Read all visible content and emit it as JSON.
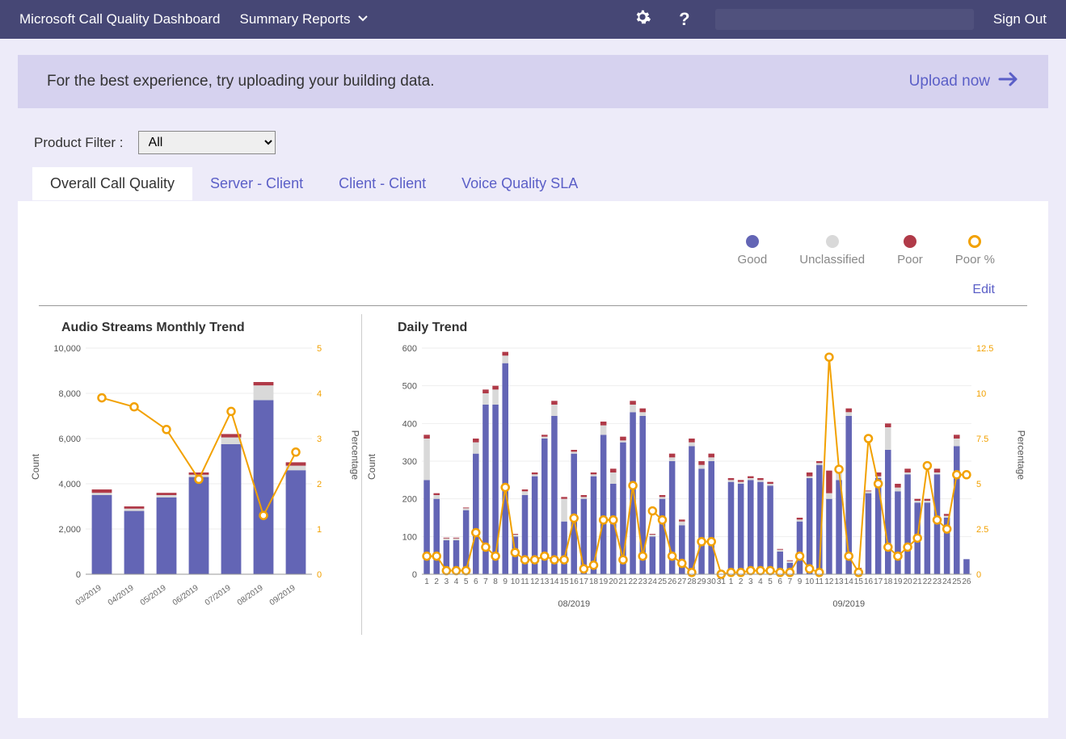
{
  "header": {
    "appname": "Microsoft Call Quality Dashboard",
    "report_selector": "Summary Reports",
    "signout": "Sign Out"
  },
  "banner": {
    "text": "For the best experience, try uploading your building data.",
    "action": "Upload now"
  },
  "filter": {
    "label": "Product Filter :",
    "selected": "All"
  },
  "tabs": [
    {
      "id": "overall",
      "label": "Overall Call Quality",
      "active": true
    },
    {
      "id": "server",
      "label": "Server - Client",
      "active": false
    },
    {
      "id": "client",
      "label": "Client - Client",
      "active": false
    },
    {
      "id": "sla",
      "label": "Voice Quality SLA",
      "active": false
    }
  ],
  "legend": {
    "good": "Good",
    "unclassified": "Unclassified",
    "poor": "Poor",
    "poorpct": "Poor %"
  },
  "edit_label": "Edit",
  "colors": {
    "good": "#6365b5",
    "unclassified": "#d9d9d9",
    "poor": "#b03a48",
    "poorpct": "#f2a100"
  },
  "axis_labels": {
    "count": "Count",
    "percentage": "Percentage"
  },
  "chart_data": [
    {
      "id": "monthly",
      "title": "Audio Streams Monthly Trend",
      "type": "bar+line",
      "categories": [
        "03/2019",
        "04/2019",
        "05/2019",
        "06/2019",
        "07/2019",
        "08/2019",
        "09/2019"
      ],
      "ylim_left": [
        0,
        10000
      ],
      "yticks_left": [
        0,
        2000,
        4000,
        6000,
        8000,
        10000
      ],
      "ytick_labels_left": [
        "0",
        "2,000",
        "4,000",
        "6,000",
        "8,000",
        "10,000"
      ],
      "ylim_right": [
        0,
        5
      ],
      "yticks_right": [
        0,
        1,
        2,
        3,
        4,
        5
      ],
      "series": [
        {
          "name": "Good",
          "role": "bar",
          "values": [
            3500,
            2800,
            3400,
            4300,
            5750,
            7700,
            4600
          ]
        },
        {
          "name": "Unclassified",
          "role": "bar",
          "values": [
            100,
            100,
            100,
            100,
            300,
            650,
            200
          ]
        },
        {
          "name": "Poor",
          "role": "bar",
          "values": [
            150,
            100,
            100,
            100,
            150,
            150,
            150
          ]
        },
        {
          "name": "Poor %",
          "role": "line",
          "values": [
            3.9,
            3.7,
            3.2,
            2.1,
            3.6,
            1.3,
            2.7
          ]
        }
      ]
    },
    {
      "id": "daily",
      "title": "Daily Trend",
      "type": "bar+line",
      "categories": {
        "months": [
          "08/2019",
          "09/2019"
        ],
        "days_aug": [
          1,
          2,
          3,
          4,
          5,
          6,
          7,
          8,
          9,
          10,
          11,
          12,
          13,
          14,
          15,
          16,
          17,
          18,
          19,
          20,
          21,
          22,
          23,
          24,
          25,
          26,
          27,
          28,
          29,
          30,
          31
        ],
        "days_sep": [
          1,
          2,
          3,
          4,
          5,
          6,
          7,
          9,
          10,
          11,
          12,
          13,
          14,
          15,
          16,
          17,
          18,
          19,
          20,
          21,
          22,
          23,
          24,
          25,
          26
        ]
      },
      "ylim_left": [
        0,
        600
      ],
      "yticks_left": [
        0,
        100,
        200,
        300,
        400,
        500,
        600
      ],
      "ylim_right": [
        0,
        12.5
      ],
      "yticks_right": [
        0,
        2.5,
        5,
        7.5,
        10,
        12.5
      ],
      "series": [
        {
          "name": "Good",
          "role": "bar",
          "values_aug": [
            250,
            200,
            90,
            90,
            170,
            320,
            450,
            450,
            560,
            100,
            210,
            260,
            360,
            420,
            140,
            320,
            200,
            260,
            370,
            240,
            350,
            430,
            420,
            100,
            200,
            300,
            130,
            340,
            280,
            300,
            10
          ],
          "values_sep": [
            245,
            240,
            250,
            245,
            235,
            60,
            30,
            140,
            255,
            290,
            200,
            250,
            420,
            10,
            215,
            255,
            330,
            220,
            265,
            190,
            190,
            265,
            150,
            340,
            40
          ]
        },
        {
          "name": "Unclassified",
          "role": "bar",
          "values_aug": [
            110,
            10,
            5,
            5,
            5,
            30,
            30,
            40,
            20,
            5,
            10,
            5,
            5,
            30,
            60,
            5,
            5,
            5,
            25,
            30,
            5,
            20,
            10,
            5,
            5,
            10,
            10,
            10,
            10,
            10,
            0
          ],
          "values_sep": [
            5,
            5,
            5,
            5,
            5,
            5,
            5,
            5,
            5,
            5,
            15,
            20,
            10,
            5,
            5,
            5,
            60,
            10,
            5,
            5,
            5,
            5,
            5,
            20,
            0
          ]
        },
        {
          "name": "Poor",
          "role": "bar",
          "values_aug": [
            10,
            5,
            2,
            2,
            2,
            10,
            10,
            10,
            10,
            2,
            5,
            5,
            5,
            10,
            5,
            5,
            5,
            5,
            10,
            10,
            10,
            10,
            10,
            2,
            5,
            10,
            5,
            10,
            10,
            10,
            0
          ],
          "values_sep": [
            5,
            5,
            5,
            5,
            5,
            2,
            2,
            5,
            10,
            5,
            60,
            10,
            10,
            2,
            2,
            10,
            10,
            10,
            10,
            5,
            5,
            10,
            5,
            10,
            0
          ]
        },
        {
          "name": "Poor %",
          "role": "line",
          "values_aug": [
            1.0,
            1.0,
            0.2,
            0.2,
            0.2,
            2.3,
            1.5,
            1.0,
            4.8,
            1.2,
            0.8,
            0.8,
            1.0,
            0.8,
            0.8,
            3.1,
            0.3,
            0.5,
            3.0,
            3.0,
            0.8,
            4.9,
            1.0,
            3.5,
            3.0,
            1.0,
            0.6,
            0.1,
            1.8,
            1.8,
            0.0
          ],
          "values_sep": [
            0.1,
            0.1,
            0.2,
            0.2,
            0.2,
            0.1,
            0.1,
            1.0,
            0.3,
            0.1,
            12.0,
            5.8,
            1.0,
            0.1,
            7.5,
            5.0,
            1.5,
            1.0,
            1.5,
            2.0,
            6.0,
            3.0,
            2.5,
            5.5,
            5.5
          ]
        }
      ]
    }
  ]
}
